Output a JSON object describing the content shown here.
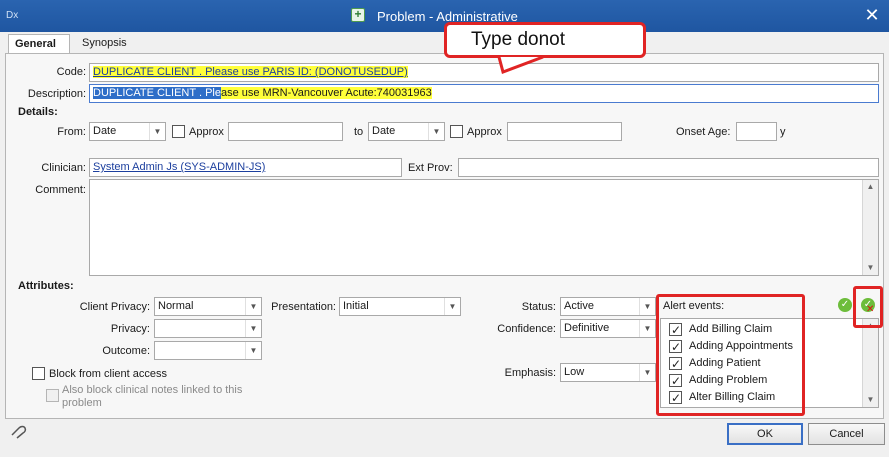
{
  "window": {
    "app_label": "Dx",
    "title": "Problem - Administrative",
    "close_glyph": "✕"
  },
  "tabs": [
    {
      "label": "General",
      "active": true
    },
    {
      "label": "Synopsis",
      "active": false
    }
  ],
  "annotation": {
    "callout_text": "Type donot",
    "color": "#e02424"
  },
  "fields": {
    "code_label": "Code:",
    "code_value": "DUPLICATE CLIENT .  Please use PARIS ID: (DONOTUSEDUP)",
    "description_label": "Description:",
    "description_selected": "DUPLICATE CLIENT . Ple",
    "description_rest": "ase use MRN-Vancouver Acute:740031963"
  },
  "details": {
    "section_label": "Details:",
    "from_label": "From:",
    "from_value": "Date",
    "approx_label": "Approx",
    "to_label": "to",
    "to_value": "Date",
    "approx2_label": "Approx",
    "onset_age_label": "Onset Age:",
    "onset_unit": "y",
    "clinician_label": "Clinician:",
    "clinician_value": "System Admin Js (SYS-ADMIN-JS)",
    "ext_prov_label": "Ext Prov:",
    "comment_label": "Comment:"
  },
  "attributes": {
    "section_label": "Attributes:",
    "client_privacy_label": "Client Privacy:",
    "client_privacy_value": "Normal",
    "privacy_label": "Privacy:",
    "outcome_label": "Outcome:",
    "presentation_label": "Presentation:",
    "presentation_value": "Initial",
    "status_label": "Status:",
    "status_value": "Active",
    "confidence_label": "Confidence:",
    "confidence_value": "Definitive",
    "emphasis_label": "Emphasis:",
    "emphasis_value": "Low",
    "block_label": "Block from client access",
    "also_block_line1": "Also block clinical notes linked to this",
    "also_block_line2": "problem",
    "alert_events_label": "Alert events:",
    "alert_events": [
      {
        "label": "Add Billing Claim",
        "checked": true
      },
      {
        "label": "Adding Appointments",
        "checked": true
      },
      {
        "label": "Adding Patient",
        "checked": true
      },
      {
        "label": "Adding Problem",
        "checked": true
      },
      {
        "label": "Alter Billing Claim",
        "checked": true
      }
    ]
  },
  "buttons": {
    "ok": "OK",
    "cancel": "Cancel"
  },
  "icons": {
    "title": "add-document-icon",
    "select_all": "green-check-icon",
    "clear_all": "green-check-cross-icon",
    "footer": "attachment-icon",
    "dropdown": "▼",
    "scroll_up": "▲",
    "scroll_down": "▼"
  }
}
